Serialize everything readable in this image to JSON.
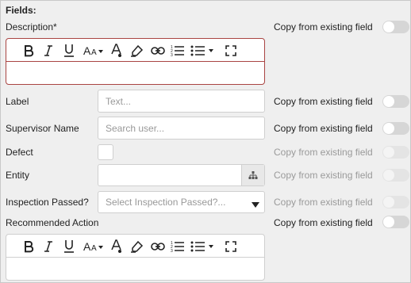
{
  "heading": "Fields:",
  "copy_label": "Copy from existing field",
  "fields": {
    "description": {
      "label": "Description*"
    },
    "label": {
      "label": "Label",
      "placeholder": "Text..."
    },
    "supervisor": {
      "label": "Supervisor Name",
      "placeholder": "Search user..."
    },
    "defect": {
      "label": "Defect"
    },
    "entity": {
      "label": "Entity"
    },
    "inspection": {
      "label": "Inspection Passed?",
      "placeholder": "Select Inspection Passed?..."
    },
    "recommended": {
      "label": "Recommended Action"
    }
  },
  "toolbar": {
    "bold": "bold-icon",
    "italic": "italic-icon",
    "underline": "underline-icon",
    "font_size": "font-size-icon",
    "text_color": "text-color-icon",
    "highlight": "highlighter-icon",
    "link": "link-icon",
    "ordered_list": "ordered-list-icon",
    "bullet_list": "bullet-list-icon",
    "fullscreen": "fullscreen-icon"
  },
  "colors": {
    "invalid_border": "#a94442",
    "background": "#efefef"
  }
}
